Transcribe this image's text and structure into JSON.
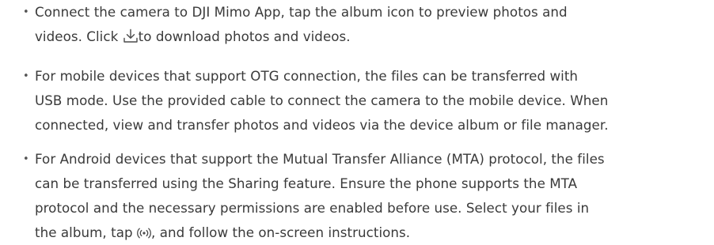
{
  "bullets": [
    {
      "glyph": "•",
      "lines": [
        "Connect the camera to DJI Mimo App, tap the album icon to preview photos and"
      ],
      "line2_before": "videos. Click ",
      "line2_icon": "download-icon",
      "line2_after": "to download photos and videos."
    },
    {
      "glyph": "•",
      "lines": [
        "For mobile devices that support OTG connection, the files can be transferred with",
        "USB mode. Use the provided cable to connect the camera to the mobile device. When",
        "connected, view and transfer photos and videos via the device album or file manager."
      ]
    },
    {
      "glyph": "•",
      "lines": [
        "For Android devices that support the Mutual Transfer Alliance (MTA) protocol, the files",
        "can be transferred using the Sharing feature. Ensure the phone supports the MTA",
        "protocol and the necessary permissions are enabled before use. Select your files in"
      ],
      "line4_before": "the album, tap ",
      "line4_icon": "sharing-icon",
      "line4_after": ", and follow the on-screen instructions."
    }
  ],
  "colors": {
    "text": "#3a3a3a",
    "bullet": "#555555"
  }
}
